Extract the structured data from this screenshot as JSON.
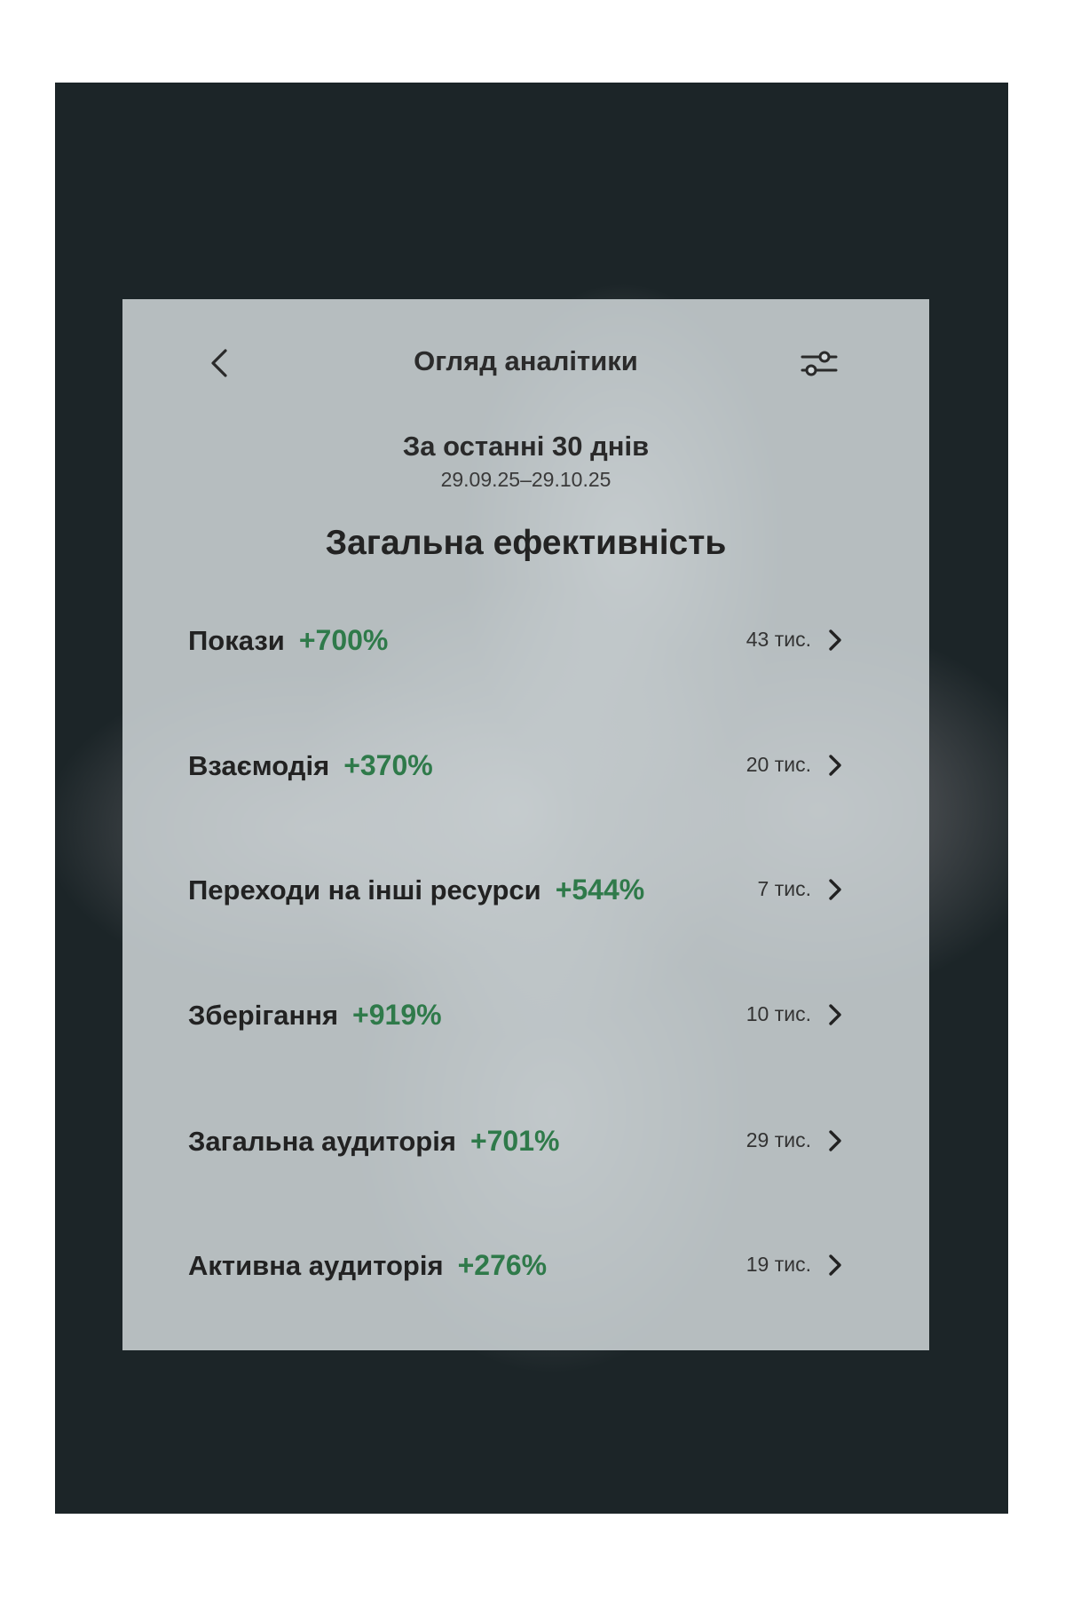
{
  "header": {
    "title": "Огляд аналітики"
  },
  "period": {
    "label": "За останні 30 днів",
    "range": "29.09.25–29.10.25"
  },
  "section_title": "Загальна ефективність",
  "metrics": [
    {
      "label": "Покази",
      "change": "+700%",
      "value": "43 тис."
    },
    {
      "label": "Взаємодія",
      "change": "+370%",
      "value": "20 тис."
    },
    {
      "label": "Переходи на інші ресурси",
      "change": "+544%",
      "value": "7 тис."
    },
    {
      "label": "Зберігання",
      "change": "+919%",
      "value": "10 тис."
    },
    {
      "label": "Загальна аудиторія",
      "change": "+701%",
      "value": "29 тис."
    },
    {
      "label": "Активна аудиторія",
      "change": "+276%",
      "value": "19 тис."
    }
  ],
  "colors": {
    "positive_change": "#2f7a4a",
    "panel": "#cfd6d8",
    "background": "#1c2528"
  },
  "icons": {
    "back": "chevron-left-icon",
    "filter": "sliders-icon",
    "row": "chevron-right-icon"
  }
}
